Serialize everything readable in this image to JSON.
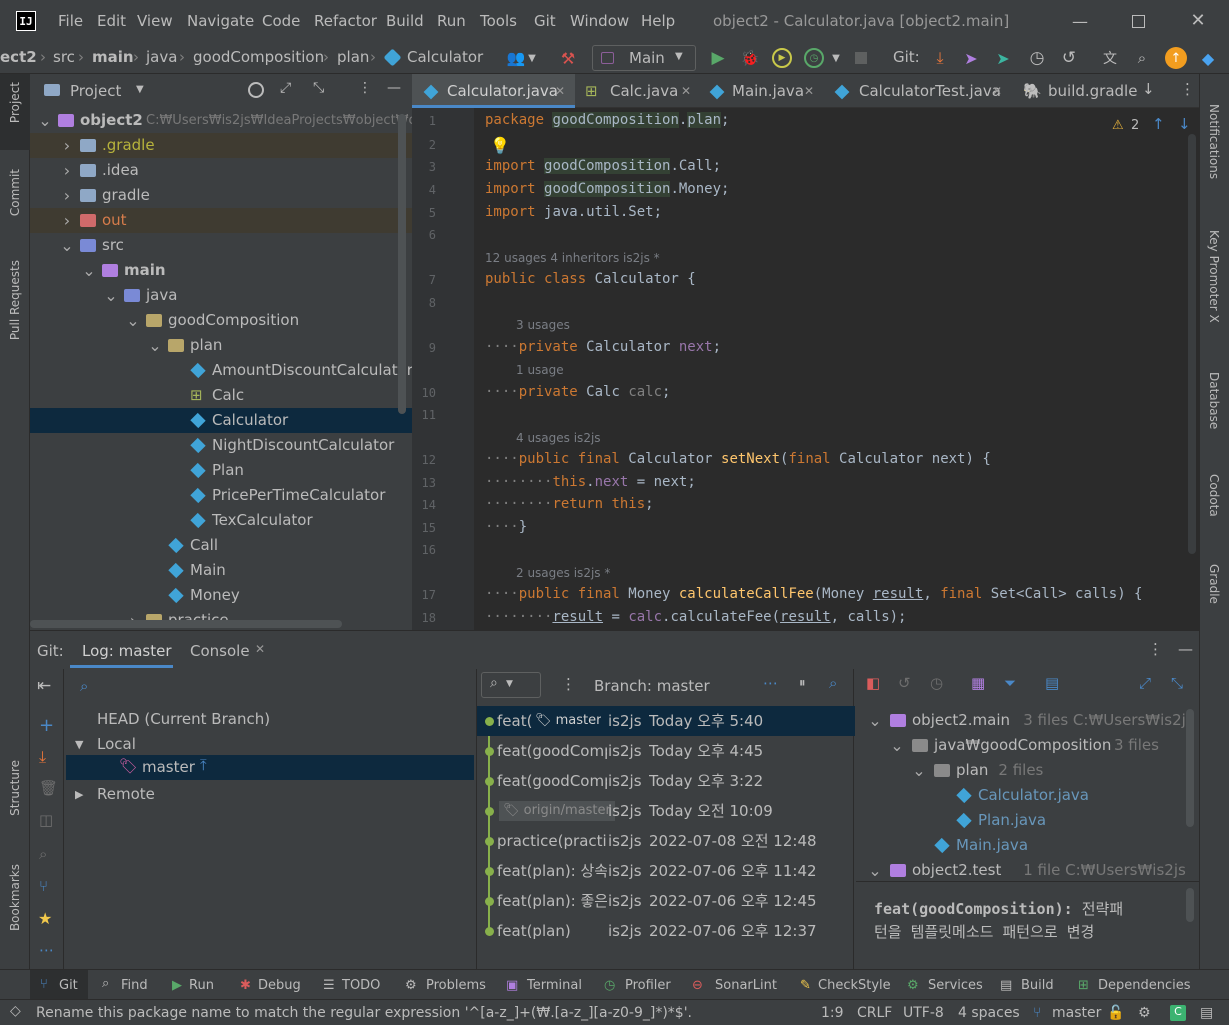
{
  "window": {
    "title": "object2 - Calculator.java [object2.main]",
    "menu": [
      "File",
      "Edit",
      "View",
      "Navigate",
      "Code",
      "Refactor",
      "Build",
      "Run",
      "Tools",
      "Git",
      "Window",
      "Help"
    ]
  },
  "breadcrumb": [
    "ect2",
    "src",
    "main",
    "java",
    "goodComposition",
    "plan",
    "Calculator"
  ],
  "toolbar": {
    "run_config": "Main",
    "git_label": "Git:"
  },
  "left_strip": {
    "project": "Project",
    "commit": "Commit",
    "pull_requests": "Pull Requests",
    "structure": "Structure",
    "bookmarks": "Bookmarks"
  },
  "right_strip": {
    "notifications": "Notifications",
    "key_promoter": "Key Promoter X",
    "database": "Database",
    "codota": "Codota",
    "gradle": "Gradle"
  },
  "project_panel": {
    "title": "Project",
    "tree": [
      {
        "label": "object2",
        "extra": "C:₩Users₩is2js₩IdeaProjects₩object₩ob",
        "depth": 0,
        "state": "open",
        "color": "#bbbbbb",
        "bold": true
      },
      {
        "label": ".gradle",
        "depth": 1,
        "state": "closed",
        "color": "#b7b33c",
        "bold": false
      },
      {
        "label": ".idea",
        "depth": 1,
        "state": "closed",
        "color": "#bbbbbb",
        "bold": false
      },
      {
        "label": "gradle",
        "depth": 1,
        "state": "closed",
        "color": "#bbbbbb",
        "bold": false
      },
      {
        "label": "out",
        "depth": 1,
        "state": "closed",
        "color": "#d67c4b",
        "bold": false
      },
      {
        "label": "src",
        "depth": 1,
        "state": "open",
        "color": "#bbbbbb",
        "bold": false
      },
      {
        "label": "main",
        "depth": 2,
        "state": "open",
        "color": "#bbbbbb",
        "bold": true
      },
      {
        "label": "java",
        "depth": 3,
        "state": "open",
        "color": "#bbbbbb",
        "bold": false
      },
      {
        "label": "goodComposition",
        "depth": 4,
        "state": "open",
        "color": "#bbbbbb",
        "bold": false
      },
      {
        "label": "plan",
        "depth": 5,
        "state": "open",
        "color": "#bbbbbb",
        "bold": false
      },
      {
        "label": "AmountDiscountCalculator",
        "depth": 6,
        "state": "leaf",
        "color": "#bbbbbb",
        "bold": false
      },
      {
        "label": "Calc",
        "depth": 6,
        "state": "leaf",
        "color": "#bbbbbb",
        "bold": false
      },
      {
        "label": "Calculator",
        "depth": 6,
        "state": "leaf",
        "color": "#bbbbbb",
        "bold": false
      },
      {
        "label": "NightDiscountCalculator",
        "depth": 6,
        "state": "leaf",
        "color": "#bbbbbb",
        "bold": false
      },
      {
        "label": "Plan",
        "depth": 6,
        "state": "leaf",
        "color": "#bbbbbb",
        "bold": false
      },
      {
        "label": "PricePerTimeCalculator",
        "depth": 6,
        "state": "leaf",
        "color": "#bbbbbb",
        "bold": false
      },
      {
        "label": "TexCalculator",
        "depth": 6,
        "state": "leaf",
        "color": "#bbbbbb",
        "bold": false
      },
      {
        "label": "Call",
        "depth": 5,
        "state": "leaf",
        "color": "#bbbbbb",
        "bold": false
      },
      {
        "label": "Main",
        "depth": 5,
        "state": "leaf",
        "color": "#bbbbbb",
        "bold": false
      },
      {
        "label": "Money",
        "depth": 5,
        "state": "leaf",
        "color": "#bbbbbb",
        "bold": false
      },
      {
        "label": "practice",
        "depth": 4,
        "state": "closed",
        "color": "#bbbbbb",
        "bold": false
      }
    ]
  },
  "editor_tabs": [
    "Calculator.java",
    "Calc.java",
    "Main.java",
    "CalculatorTest.java",
    "build.gradle"
  ],
  "editor": {
    "warnings": "2",
    "line_numbers": [
      "1",
      "2",
      "3",
      "4",
      "5",
      "6",
      "7",
      "8",
      "9",
      "10",
      "11",
      "12",
      "13",
      "14",
      "15",
      "16",
      "17",
      "18"
    ],
    "hints": {
      "class": "12 usages   4 inheritors   is2js *",
      "next": "3 usages",
      "calc": "1 usage",
      "setNext": "4 usages   is2js",
      "fee": "2 usages   is2js *"
    }
  },
  "bottom_panel": {
    "tabs": [
      "Git:",
      "Log: master",
      "Console"
    ],
    "branches": {
      "head": "HEAD (Current Branch)",
      "local": "Local",
      "master": "master",
      "remote": "Remote"
    },
    "branch_filter": "Branch: master",
    "commits": [
      {
        "msg": "feat(",
        "tag": "master",
        "author": "is2js",
        "date": "Today 오후 5:40"
      },
      {
        "msg": "feat(goodComp",
        "tag": "",
        "author": "is2js",
        "date": "Today 오후 4:45"
      },
      {
        "msg": "feat(goodComp",
        "tag": "",
        "author": "is2js",
        "date": "Today 오후 3:22"
      },
      {
        "msg": "",
        "tag": "origin/master",
        "author": "is2js",
        "date": "Today 오전 10:09"
      },
      {
        "msg": "practice(practice",
        "tag": "",
        "author": "is2js",
        "date": "2022-07-08 오전 12:48"
      },
      {
        "msg": "feat(plan): 상속",
        "tag": "",
        "author": "is2js",
        "date": "2022-07-06 오후 11:42"
      },
      {
        "msg": "feat(plan): 좋은",
        "tag": "",
        "author": "is2js",
        "date": "2022-07-06 오후 12:45"
      },
      {
        "msg": "feat(plan)",
        "tag": "",
        "author": "is2js",
        "date": "2022-07-06 오후 12:37"
      }
    ],
    "changes": [
      {
        "label": "object2.main",
        "extra": "3 files  C:₩Users₩is2js₩IdeaP",
        "depth": 0
      },
      {
        "label": "java₩goodComposition",
        "extra": "3 files",
        "depth": 1
      },
      {
        "label": "plan",
        "extra": "2 files",
        "depth": 2
      },
      {
        "label": "Calculator.java",
        "extra": "",
        "depth": 3
      },
      {
        "label": "Plan.java",
        "extra": "",
        "depth": 3
      },
      {
        "label": "Main.java",
        "extra": "",
        "depth": 2
      },
      {
        "label": "object2.test",
        "extra": "1 file  C:₩Users₩is2js₩IdeaPro",
        "depth": 0
      }
    ],
    "commit_message_bold": "feat(goodComposition):",
    "commit_message_rest": " 전략패",
    "commit_message_line2": "턴을 템플릿메소드 패턴으로 변경"
  },
  "tool_windows": [
    "Git",
    "Find",
    "Run",
    "Debug",
    "TODO",
    "Problems",
    "Terminal",
    "Profiler",
    "SonarLint",
    "CheckStyle",
    "Services",
    "Build",
    "Dependencies"
  ],
  "status": {
    "message": "Rename this package name to match the regular expression '^[a-z_]+(₩.[a-z_][a-z0-9_]*)*$'.",
    "position": "1:9",
    "line_sep": "CRLF",
    "encoding": "UTF-8",
    "indent": "4 spaces",
    "branch": "master"
  },
  "colors": {
    "accent": "#4a88c7",
    "selection": "#0d293e",
    "keyword": "#cc7832",
    "string": "#6a8759",
    "field": "#9876aa",
    "method": "#ffc66d"
  }
}
